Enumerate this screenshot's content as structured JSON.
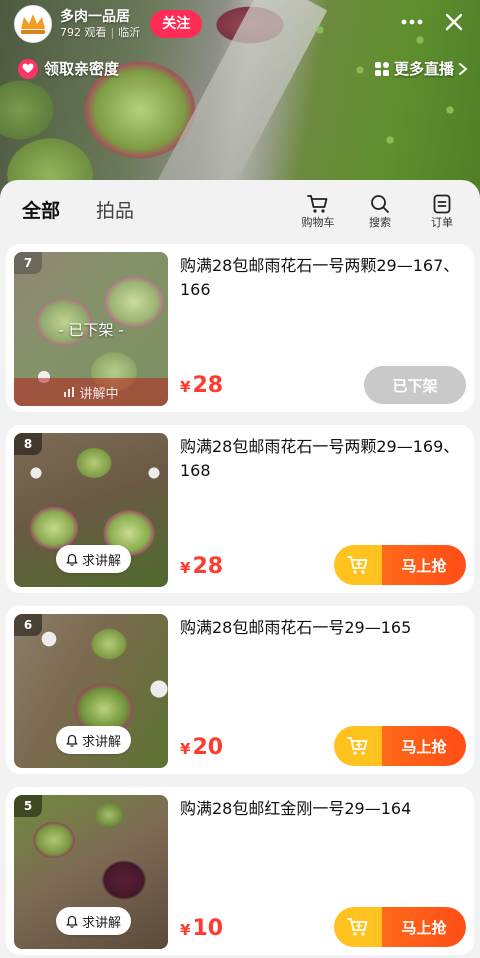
{
  "live": {
    "anchor_name": "多肉一品居",
    "viewers": "792 观看",
    "location": "临沂",
    "follow_label": "关注",
    "intimacy_label": "领取亲密度",
    "more_live_label": "更多直播"
  },
  "sheet": {
    "tabs": [
      {
        "label": "全部",
        "active": true
      },
      {
        "label": "拍品",
        "active": false
      }
    ],
    "tools": [
      {
        "label": "购物车",
        "icon": "cart-icon"
      },
      {
        "label": "搜索",
        "icon": "search-icon"
      },
      {
        "label": "订单",
        "icon": "order-icon"
      }
    ]
  },
  "products": [
    {
      "index": "7",
      "title": "购满28包邮雨花石一号两颗29—167、166",
      "currency": "¥",
      "price": "28",
      "status": "off_shelf",
      "overlay_text": "- 已下架 -",
      "strip_text": "讲解中",
      "button_label": "已下架"
    },
    {
      "index": "8",
      "title": "购满28包邮雨花石一号两颗29—169、168",
      "currency": "¥",
      "price": "28",
      "status": "available",
      "chip_text": "求讲解",
      "button_label": "马上抢"
    },
    {
      "index": "6",
      "title": "购满28包邮雨花石一号29—165",
      "currency": "¥",
      "price": "20",
      "status": "available",
      "chip_text": "求讲解",
      "button_label": "马上抢"
    },
    {
      "index": "5",
      "title": "购满28包邮红金刚一号29—164",
      "currency": "¥",
      "price": "10",
      "status": "available",
      "chip_text": "求讲解",
      "button_label": "马上抢"
    }
  ],
  "colors": {
    "follow": "#ff2d55",
    "price": "#ff3a2e",
    "buy_left": "#ffc21f",
    "buy_right": "#ff5a17",
    "offshelf_button": "#c9c9c9"
  }
}
